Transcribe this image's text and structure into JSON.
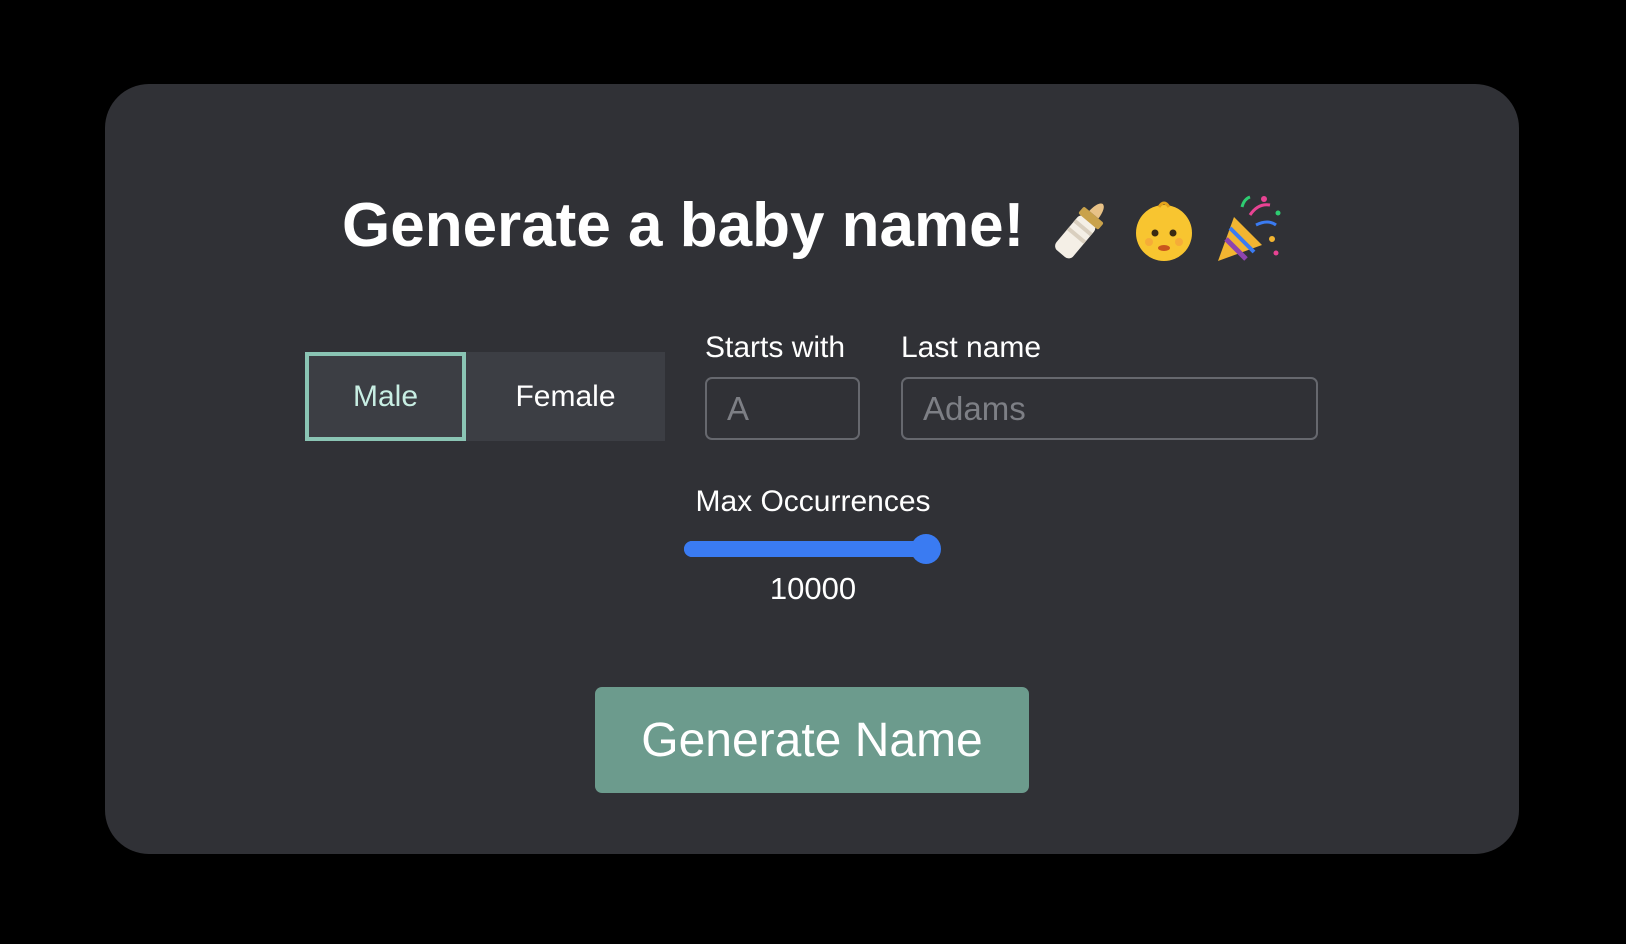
{
  "header": {
    "title": "Generate a baby name!",
    "emojis": [
      "baby-bottle-icon",
      "baby-face-icon",
      "party-popper-icon"
    ]
  },
  "gender": {
    "options": [
      {
        "label": "Male",
        "selected": true
      },
      {
        "label": "Female",
        "selected": false
      }
    ]
  },
  "starts_with": {
    "label": "Starts with",
    "value": "",
    "placeholder": "A"
  },
  "last_name": {
    "label": "Last name",
    "value": "",
    "placeholder": "Adams"
  },
  "max_occurrences": {
    "label": "Max Occurrences",
    "value": "10000",
    "fraction": 1.0
  },
  "actions": {
    "generate_label": "Generate Name"
  },
  "colors": {
    "background": "#000000",
    "card": "#303136",
    "accent_green": "#6c9b8d",
    "selected_border": "#8ac4b4",
    "slider_blue": "#3a7bf2"
  }
}
